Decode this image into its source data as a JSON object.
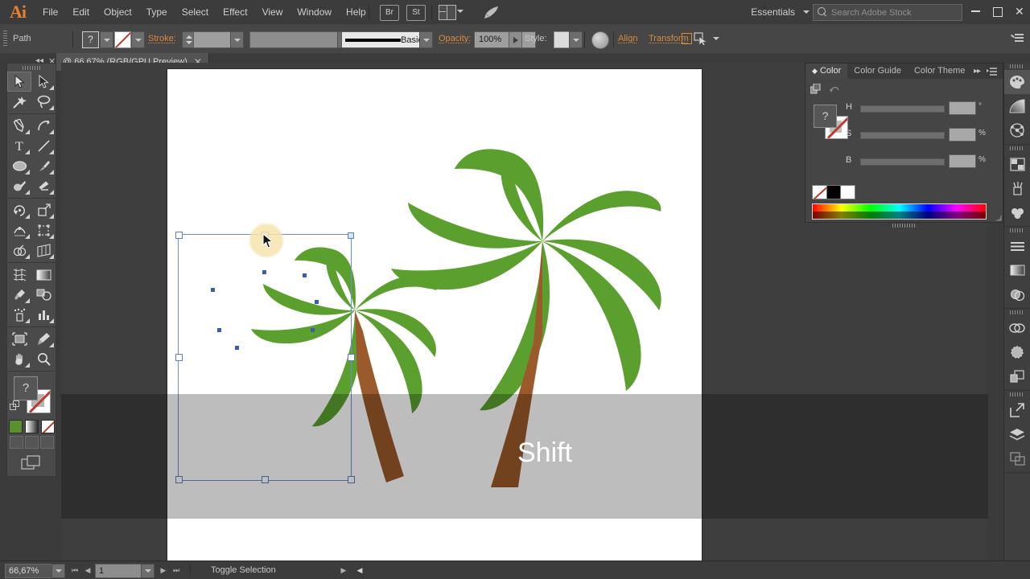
{
  "app": {
    "name": "Adobe Illustrator",
    "logo_text": "Ai",
    "workspace": "Essentials"
  },
  "menubar": {
    "items": [
      "File",
      "Edit",
      "Object",
      "Type",
      "Select",
      "Effect",
      "View",
      "Window",
      "Help"
    ],
    "bridge_label": "Br",
    "stock_label": "St",
    "search_placeholder": "Search Adobe Stock",
    "window_controls": {
      "minimize": "—",
      "maximize": "□",
      "close": "✕"
    }
  },
  "control_bar": {
    "object_type": "Path",
    "fill_label": "?",
    "stroke_label": "Stroke:",
    "stroke_weight": "",
    "stroke_profile": "",
    "brush_name": "Basic",
    "opacity_label": "Opacity:",
    "opacity_value": "100%",
    "style_label": "Style:",
    "align_label": "Align",
    "transform_label": "Transform"
  },
  "document": {
    "tab_title": "@ 66,67% (RGB/GPU Preview)",
    "close_glyph": "✕"
  },
  "tools": [
    {
      "name": "selection-tool",
      "active": true
    },
    {
      "name": "direct-selection-tool",
      "active": false
    },
    {
      "name": "magic-wand-tool",
      "active": false
    },
    {
      "name": "lasso-tool",
      "active": false
    },
    {
      "name": "pen-tool",
      "active": false
    },
    {
      "name": "curvature-tool",
      "active": false
    },
    {
      "name": "type-tool",
      "active": false
    },
    {
      "name": "line-segment-tool",
      "active": false
    },
    {
      "name": "ellipse-tool",
      "active": false
    },
    {
      "name": "paintbrush-tool",
      "active": false
    },
    {
      "name": "blob-brush-tool",
      "active": false
    },
    {
      "name": "eraser-tool",
      "active": false
    },
    {
      "name": "rotate-tool",
      "active": false
    },
    {
      "name": "scale-tool",
      "active": false
    },
    {
      "name": "width-tool",
      "active": false
    },
    {
      "name": "free-transform-tool",
      "active": false
    },
    {
      "name": "shape-builder-tool",
      "active": false
    },
    {
      "name": "perspective-grid-tool",
      "active": false
    },
    {
      "name": "mesh-tool",
      "active": false
    },
    {
      "name": "gradient-tool",
      "active": false
    },
    {
      "name": "eyedropper-tool",
      "active": false
    },
    {
      "name": "blend-tool",
      "active": false
    },
    {
      "name": "symbol-sprayer-tool",
      "active": false
    },
    {
      "name": "column-graph-tool",
      "active": false
    },
    {
      "name": "artboard-tool",
      "active": false
    },
    {
      "name": "slice-tool",
      "active": false
    },
    {
      "name": "hand-tool",
      "active": false
    },
    {
      "name": "zoom-tool",
      "active": false
    }
  ],
  "tool_swatches": {
    "fill_glyph": "?",
    "mini": [
      "#5c8f2f",
      "#gradient",
      "#none"
    ]
  },
  "color_panel": {
    "tabs": [
      {
        "label": "Color",
        "active": true
      },
      {
        "label": "Color Guide",
        "active": false
      },
      {
        "label": "Color Theme",
        "active": false
      }
    ],
    "fill_glyph": "?",
    "sliders": [
      {
        "label": "H",
        "value": "",
        "unit": "°"
      },
      {
        "label": "S",
        "value": "",
        "unit": "%"
      },
      {
        "label": "B",
        "value": "",
        "unit": "%"
      }
    ]
  },
  "dock": {
    "groups": [
      [
        "color-icon",
        "gradient-icon",
        "color-guide-icon"
      ],
      [
        "swatches-icon",
        "brushes-icon",
        "symbols-icon"
      ],
      [
        "stroke-icon",
        "gradient-panel-icon",
        "transparency-icon"
      ],
      [
        "pathfinder-icon",
        "align-icon",
        "layers-stack-icon"
      ],
      [
        "export-icon",
        "layers-icon",
        "artboards-icon"
      ]
    ]
  },
  "canvas": {
    "artwork_description": "Two palm trees illustration on white artboard",
    "palm_green": "#5ba02e",
    "palm_trunk": "#9a5a2b",
    "selection_color": "#6b8fce",
    "key_overlay": "Shift"
  },
  "status_bar": {
    "zoom_level": "66,67%",
    "page_number": "1",
    "status_text": "Toggle Selection"
  }
}
